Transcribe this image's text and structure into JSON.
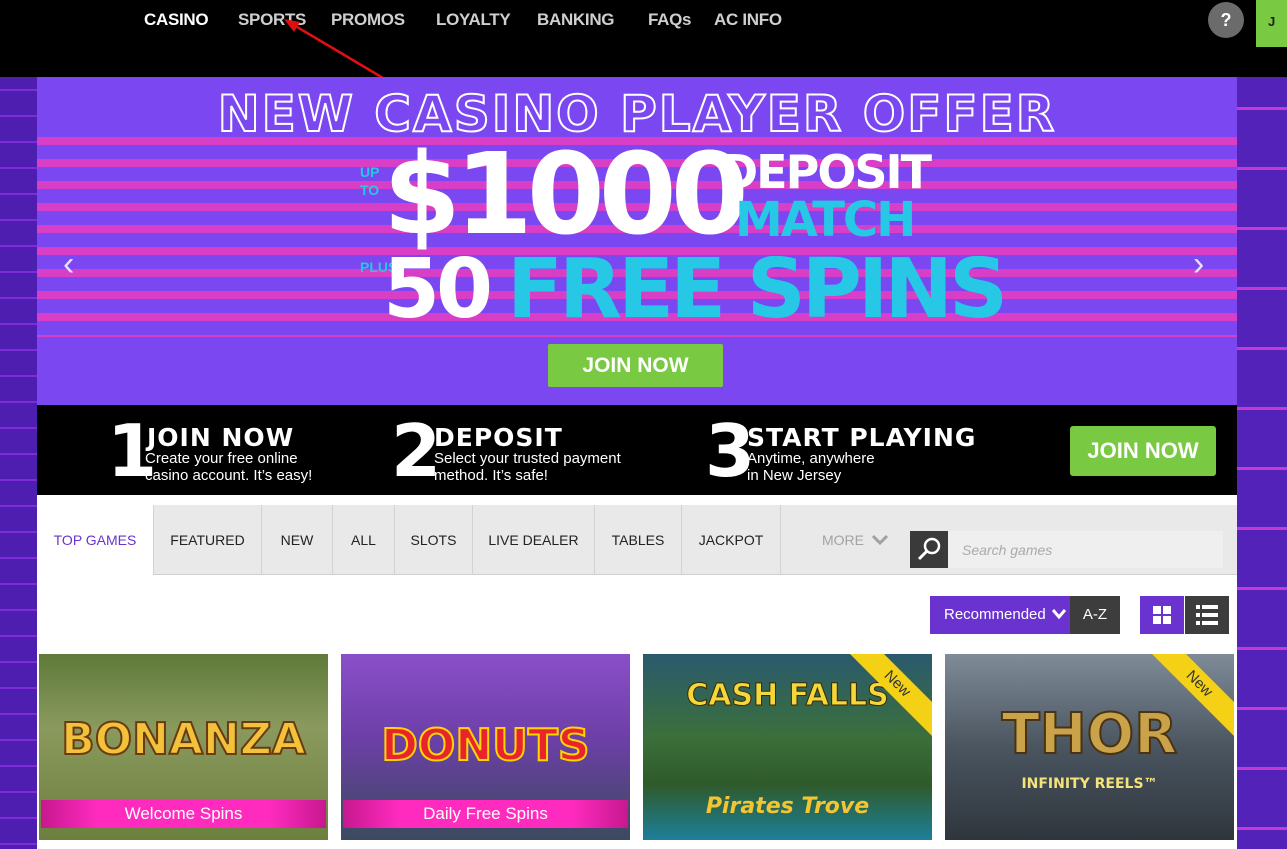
{
  "nav": {
    "items": [
      "CASINO",
      "SPORTS",
      "PROMOS",
      "LOYALTY",
      "BANKING",
      "FAQs",
      "AC INFO"
    ],
    "help_label": "?",
    "join_label": "J"
  },
  "banner": {
    "headline": "NEW CASINO PLAYER OFFER",
    "up_to": "UP TO",
    "amount": "$1000",
    "deposit": "DEPOSIT",
    "match": "MATCH",
    "plus": "PLUS",
    "spins_number": "50",
    "spins_text": "FREE SPINS",
    "join_label": "JOIN NOW",
    "prev_arrow": "‹",
    "next_arrow": "›"
  },
  "steps": {
    "items": [
      {
        "num": "1",
        "title": "JOIN NOW",
        "desc1": "Create your free online",
        "desc2": "casino account. It’s easy!"
      },
      {
        "num": "2",
        "title": "DEPOSIT",
        "desc1": "Select your trusted payment",
        "desc2": "method. It’s safe!"
      },
      {
        "num": "3",
        "title": "START PLAYING",
        "desc1": "Anytime, anywhere",
        "desc2": "in New Jersey"
      }
    ],
    "join_label": "JOIN NOW"
  },
  "tabs": {
    "items": [
      "TOP GAMES",
      "FEATURED",
      "NEW",
      "ALL",
      "SLOTS",
      "LIVE DEALER",
      "TABLES",
      "JACKPOT"
    ],
    "more_label": "MORE"
  },
  "search": {
    "placeholder": "Search games"
  },
  "sort": {
    "selected": "Recommended",
    "az_label": "A-Z"
  },
  "games": [
    {
      "title": "BONANZA",
      "label": "Welcome Spins",
      "badge": ""
    },
    {
      "title": "DONUTS",
      "label": "Daily Free Spins",
      "badge": ""
    },
    {
      "title": "CASH FALLS",
      "subtitle": "Pirates Trove",
      "label": "",
      "badge": "New"
    },
    {
      "title": "THOR",
      "subtitle": "INFINITY REELS™",
      "label": "",
      "badge": "New"
    }
  ],
  "colors": {
    "accent_purple": "#6a33cf",
    "cta_green": "#7ac943",
    "banner_cyan": "#27c7e6",
    "label_pink": "#ff2bbf"
  }
}
